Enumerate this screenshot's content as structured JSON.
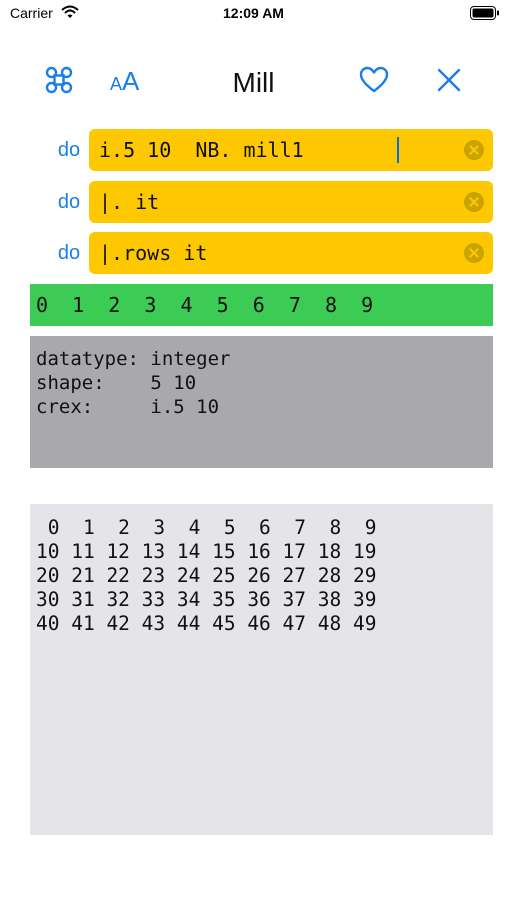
{
  "status_bar": {
    "carrier": "Carrier",
    "time": "12:09 AM"
  },
  "toolbar": {
    "title": "Mill",
    "icons": [
      "command-icon",
      "text-size-icon",
      "heart-icon",
      "close-icon"
    ],
    "text_size_small": "A",
    "text_size_large": "A",
    "accent_color": "#1a7ee8"
  },
  "commands": [
    {
      "label": "do",
      "value": "i.5 10  NB. mill1"
    },
    {
      "label": "do",
      "value": "|. it"
    },
    {
      "label": "do",
      "value": "|.rows it"
    }
  ],
  "result_line": "0  1  2  3  4  5  6  7  8  9",
  "info": {
    "datatype": "datatype: integer",
    "shape": "shape:    5 10",
    "crex": "crex:     i.5 10"
  },
  "output_lines": [
    " 0  1  2  3  4  5  6  7  8  9",
    "10 11 12 13 14 15 16 17 18 19",
    "20 21 22 23 24 25 26 27 28 29",
    "30 31 32 33 34 35 36 37 38 39",
    "40 41 42 43 44 45 46 47 48 49"
  ],
  "colors": {
    "field": "#fec800",
    "result": "#3ccb55",
    "info_panel": "#a9a9ad",
    "output_panel": "#e4e4e9"
  }
}
